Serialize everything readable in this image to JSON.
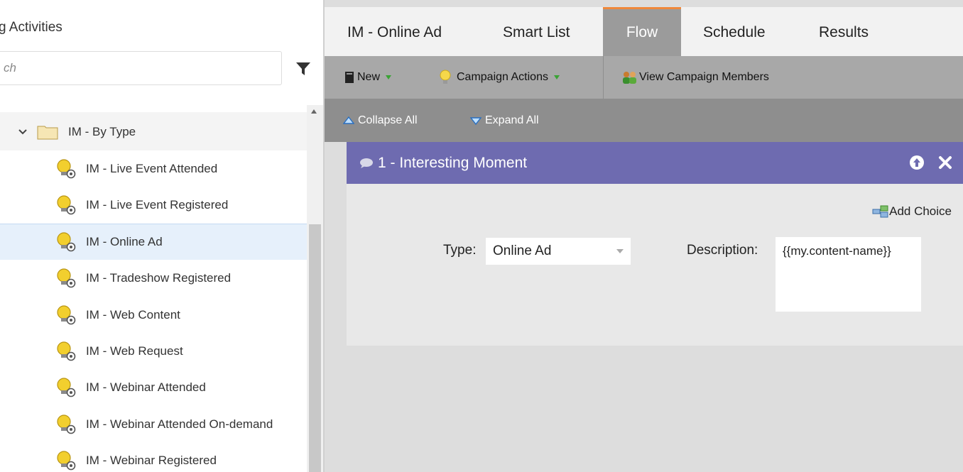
{
  "sidebar": {
    "title": "g Activities",
    "search_placeholder": "ch",
    "folder": {
      "label": "IM - By Type"
    },
    "items": [
      {
        "label": "IM - Live Event Attended"
      },
      {
        "label": "IM - Live Event Registered"
      },
      {
        "label": "IM - Online Ad",
        "selected": true
      },
      {
        "label": "IM - Tradeshow Registered"
      },
      {
        "label": "IM - Web Content"
      },
      {
        "label": "IM - Web Request"
      },
      {
        "label": "IM - Webinar Attended"
      },
      {
        "label": "IM - Webinar Attended On-demand"
      },
      {
        "label": "IM - Webinar Registered"
      }
    ]
  },
  "tabs": [
    {
      "label": "IM - Online Ad"
    },
    {
      "label": "Smart List"
    },
    {
      "label": "Flow",
      "active": true
    },
    {
      "label": "Schedule"
    },
    {
      "label": "Results"
    }
  ],
  "toolbar": {
    "new_label": "New",
    "campaign_actions_label": "Campaign Actions",
    "view_members_label": "View Campaign Members"
  },
  "subbar": {
    "collapse_label": "Collapse All",
    "expand_label": "Expand All"
  },
  "flow_step": {
    "title": "1 - Interesting Moment",
    "add_choice_label": "Add Choice",
    "type_label": "Type:",
    "type_value": "Online Ad",
    "description_label": "Description:",
    "description_value": "{{my.content-name}}"
  },
  "colors": {
    "step_header": "#6e6bb0",
    "active_tab": "#9b9b9b",
    "active_tab_accent": "#f0883a",
    "toolbar": "#a8a8a8",
    "subbar": "#8e8e8e",
    "selected_row": "#e6f0fb"
  },
  "icons": {
    "filter": "funnel-icon",
    "folder": "folder-icon",
    "item": "lightbulb-gear-icon",
    "new": "document-icon",
    "campaign_actions": "lightbulb-icon",
    "view_members": "people-icon",
    "collapse": "triangle-up-icon",
    "expand": "triangle-down-icon",
    "step": "speech-bubble-icon",
    "move_up": "arrow-up-circle-icon",
    "delete": "close-icon",
    "add_choice": "add-choice-icon"
  }
}
